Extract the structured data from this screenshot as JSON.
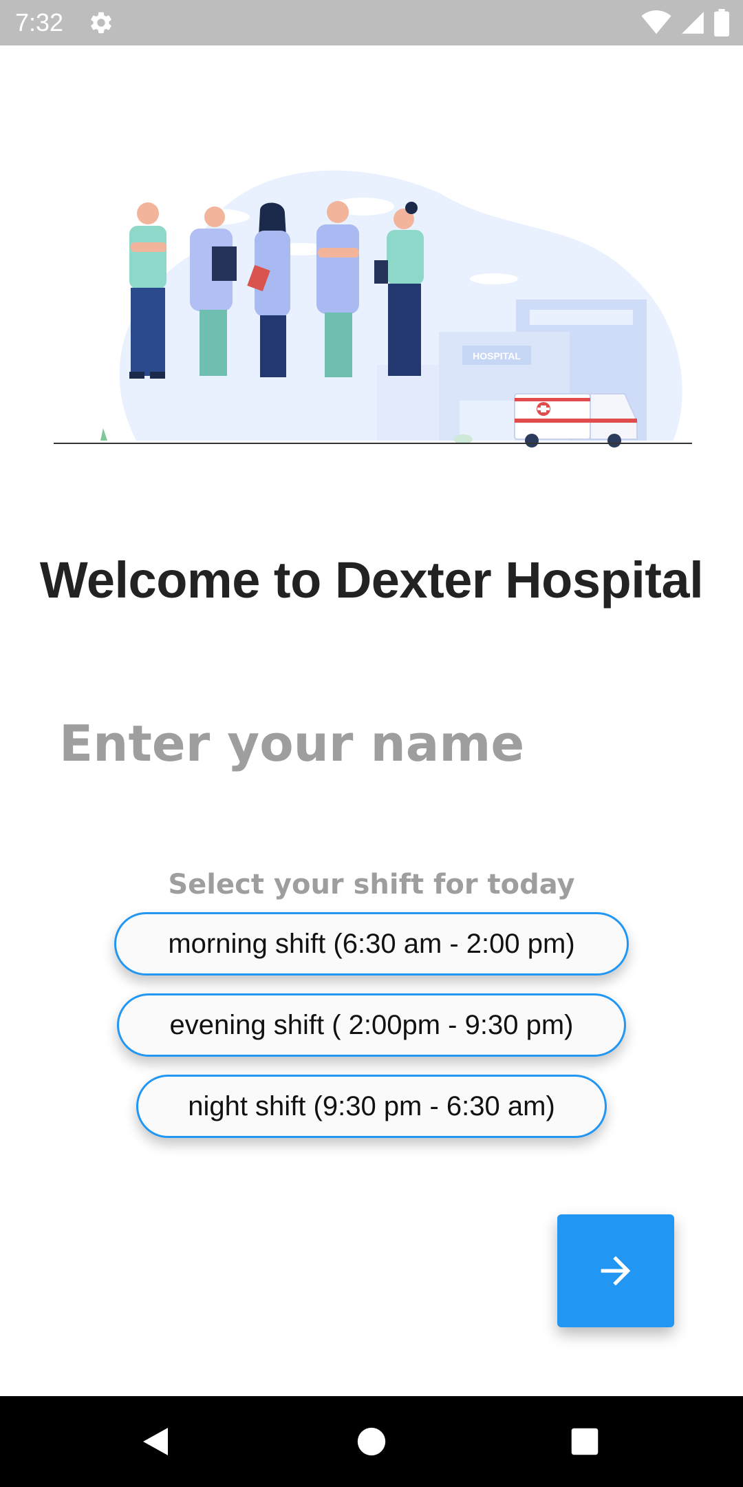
{
  "status_bar": {
    "time": "7:32",
    "icons": [
      "gear-icon",
      "wifi-icon",
      "signal-icon",
      "battery-icon"
    ]
  },
  "illustration": {
    "hospital_sign": "HOSPITAL"
  },
  "title": "Welcome to Dexter Hospital",
  "name_input": {
    "value": "",
    "placeholder": "Enter your name"
  },
  "shift_section": {
    "label": "Select your shift for today",
    "options": [
      "morning shift (6:30 am - 2:00 pm)",
      "evening shift ( 2:00pm - 9:30 pm)",
      "night shift (9:30 pm - 6:30 am)"
    ]
  },
  "fab": {
    "icon": "arrow-right-icon"
  },
  "nav_bar": {
    "icons": [
      "back-icon",
      "home-icon",
      "recents-icon"
    ]
  },
  "colors": {
    "accent": "#2196f3",
    "status_bar": "#bdbdbd",
    "nav_bar": "#000000",
    "title": "#222222",
    "placeholder": "#9e9e9e"
  }
}
